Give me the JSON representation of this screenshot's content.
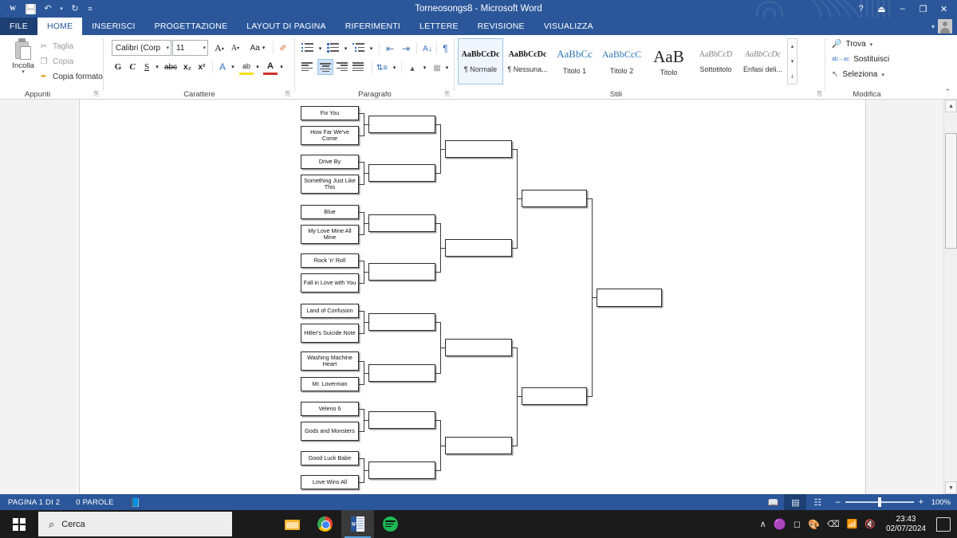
{
  "titlebar": {
    "document_title": "Torneosongs8 - Microsoft Word",
    "quick_access": [
      {
        "name": "word-logo",
        "label": "W"
      },
      {
        "name": "save",
        "label": ""
      },
      {
        "name": "undo",
        "label": "↶"
      },
      {
        "name": "undo-caret",
        "label": "▾"
      },
      {
        "name": "redo",
        "label": "↻"
      },
      {
        "name": "customize-caret",
        "label": "≡"
      }
    ],
    "window_buttons": [
      {
        "name": "help",
        "label": "?"
      },
      {
        "name": "ribbon-display-options",
        "label": "⏏"
      },
      {
        "name": "minimize",
        "label": "–"
      },
      {
        "name": "restore",
        "label": "❐"
      },
      {
        "name": "close",
        "label": "✕"
      }
    ],
    "account_caret": "▾"
  },
  "ribbon": {
    "tabs": [
      {
        "label": "FILE",
        "state": "file"
      },
      {
        "label": "HOME",
        "state": "active"
      },
      {
        "label": "INSERISCI",
        "state": "normal"
      },
      {
        "label": "PROGETTAZIONE",
        "state": "normal"
      },
      {
        "label": "LAYOUT DI PAGINA",
        "state": "normal"
      },
      {
        "label": "RIFERIMENTI",
        "state": "normal"
      },
      {
        "label": "LETTERE",
        "state": "normal"
      },
      {
        "label": "REVISIONE",
        "state": "normal"
      },
      {
        "label": "VISUALIZZA",
        "state": "normal"
      }
    ],
    "clipboard": {
      "group_label": "Appunti",
      "paste_label": "Incolla",
      "paste_caret": "▾",
      "items": [
        {
          "label": "Taglia",
          "icon": "✂"
        },
        {
          "label": "Copia",
          "icon": "❐"
        },
        {
          "label": "Copia formato",
          "icon": "✒"
        }
      ],
      "dialog_launcher": "⎘"
    },
    "font": {
      "group_label": "Carattere",
      "font_name": "Calibri (Corp",
      "font_size": "11",
      "grow_font": "A",
      "shrink_font": "A",
      "change_case": "Aa",
      "clear_formatting": "✐",
      "bold": "G",
      "italic": "C",
      "underline": "S",
      "strikethrough": "abc",
      "subscript": "x₂",
      "superscript": "x²",
      "text_effects": "A",
      "highlight": "ab",
      "font_color": "A",
      "caret": "▾",
      "dialog_launcher": "⎘"
    },
    "paragraph": {
      "group_label": "Paragrafo",
      "bullets": "bullet-list",
      "numbering": "numbered-list",
      "multilevel": "multilevel-list",
      "decrease_indent": "⇤",
      "increase_indent": "⇥",
      "sort": "A↓",
      "show_marks": "¶",
      "align_left": "align-left",
      "align_center": "align-center",
      "align_right": "align-right",
      "justify": "justify",
      "line_spacing": "line-spacing",
      "shading": "shading",
      "borders": "borders",
      "caret": "▾",
      "dialog_launcher": "⎘"
    },
    "styles": {
      "group_label": "Stili",
      "items": [
        {
          "preview": "AaBbCcDc",
          "name": "¶ Normale",
          "selected": true,
          "style": "normal"
        },
        {
          "preview": "AaBbCcDc",
          "name": "¶ Nessuna...",
          "selected": false,
          "style": "normal"
        },
        {
          "preview": "AaBbCс",
          "name": "Titolo 1",
          "selected": false,
          "style": "heading1"
        },
        {
          "preview": "AaBbCcC",
          "name": "Titolo 2",
          "selected": false,
          "style": "heading2"
        },
        {
          "preview": "AaB",
          "name": "Titolo",
          "selected": false,
          "style": "title"
        },
        {
          "preview": "AaBbCcD",
          "name": "Sottotitolo",
          "selected": false,
          "style": "subtitle"
        },
        {
          "preview": "AaBbCcDс",
          "name": "Enfasi deli...",
          "selected": false,
          "style": "emphasis"
        }
      ],
      "scroll_up": "▴",
      "scroll_down": "▾",
      "more": "⤓",
      "dialog_launcher": "⎘"
    },
    "editing": {
      "group_label": "Modifica",
      "items": [
        {
          "label": "Trova",
          "icon": "🔎",
          "caret": "▾"
        },
        {
          "label": "Sostituisci",
          "icon": "ab→ac",
          "caret": ""
        },
        {
          "label": "Seleziona",
          "icon": "↖",
          "caret": "▾"
        }
      ]
    },
    "collapse_ribbon": "⌃"
  },
  "document": {
    "bracket": {
      "round1": [
        "Fix You",
        "How Far We've Come",
        "Drive By",
        "Something Just Like This",
        "Blue",
        "My Love Mine All Mine",
        "Rock 'n' Roll",
        "Fall in Love with You",
        "Land of Confusion",
        "Hitler's Suicide Note",
        "Washing Machine Heart",
        "Mr. Loverman",
        "Veleno 6",
        "Gods and Monsters",
        "Good Luck Babe",
        "Love Wins All"
      ],
      "round2": [
        "",
        "",
        "",
        "",
        "",
        "",
        "",
        ""
      ],
      "round3": [
        "",
        "",
        "",
        ""
      ],
      "round4": [
        "",
        ""
      ],
      "champion": [
        ""
      ]
    }
  },
  "statusbar": {
    "page_info": "PAGINA 1 DI 2",
    "word_count": "0 PAROLE",
    "proofing_icon": "📖",
    "views": [
      {
        "name": "read-mode",
        "icon": "📖",
        "selected": false
      },
      {
        "name": "print-layout",
        "icon": "▤",
        "selected": true
      },
      {
        "name": "web-layout",
        "icon": "⌗",
        "selected": false
      }
    ],
    "zoom_out": "–",
    "zoom_in": "+",
    "zoom_level": "100%"
  },
  "taskbar": {
    "start_label": "start",
    "search_placeholder": "Cerca",
    "search_icon": "⌕",
    "apps": [
      {
        "name": "file-explorer",
        "active": false
      },
      {
        "name": "google-chrome",
        "active": false
      },
      {
        "name": "microsoft-word",
        "active": true
      },
      {
        "name": "spotify",
        "active": false
      }
    ],
    "tray": {
      "show_hidden": "∧",
      "icons": [
        "🟠",
        "📷",
        "🎨",
        "⌨",
        "📶",
        "🔇"
      ],
      "time": "23:43",
      "date": "02/07/2024",
      "action_center": "notification-icon"
    }
  }
}
